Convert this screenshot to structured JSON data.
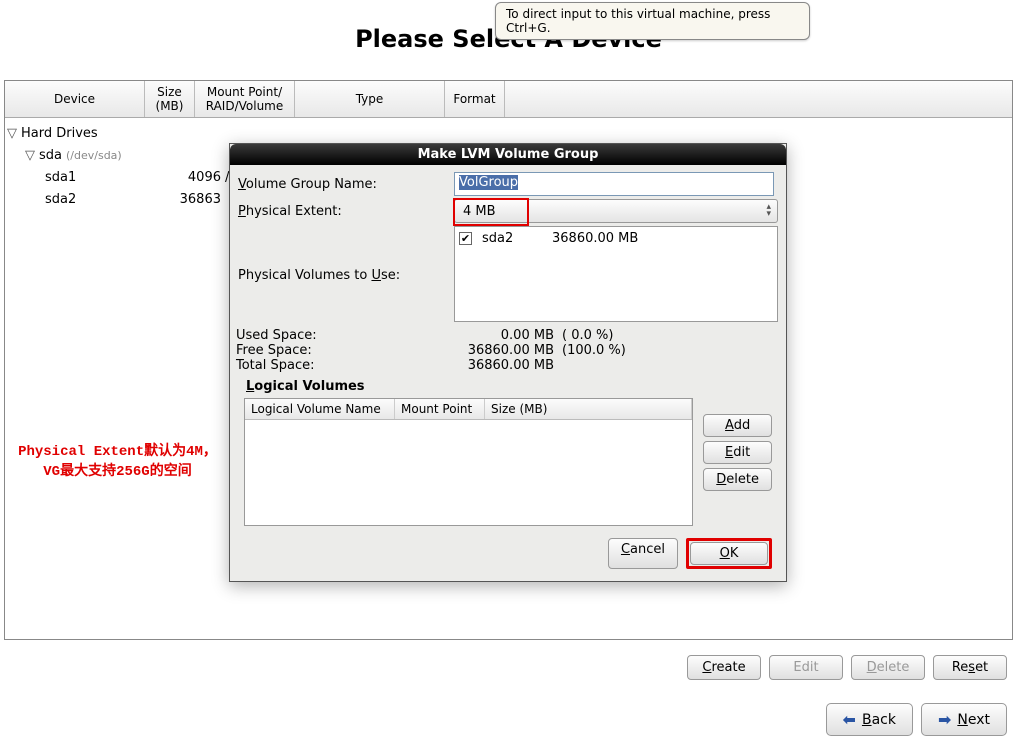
{
  "tooltip": "To direct input to this virtual machine, press Ctrl+G.",
  "page_title": "Please Select A Device",
  "columns": {
    "device": "Device",
    "size_l1": "Size",
    "size_l2": "(MB)",
    "mp_l1": "Mount Point/",
    "mp_l2": "RAID/Volume",
    "type": "Type",
    "format": "Format"
  },
  "tree": {
    "hd": "Hard Drives",
    "sda": "sda",
    "sda_hint": "(/dev/sda)",
    "rows": [
      {
        "name": "sda1",
        "size": "4096",
        "mp": "/boo"
      },
      {
        "name": "sda2",
        "size": "36863",
        "mp": ""
      }
    ]
  },
  "annotation": "Physical Extent默认为4M，\nVG最大支持256G的空间",
  "dialog": {
    "title": "Make LVM Volume Group",
    "vg_label": "Volume Group Name:",
    "vg_value": "VolGroup",
    "pe_label": "Physical Extent:",
    "pe_value": "4 MB",
    "pvu_label": "Physical Volumes to Use:",
    "pv_row": {
      "name": "sda2",
      "size": "36860.00 MB"
    },
    "stats": {
      "used_k": "Used Space:",
      "used_v": "0.00 MB",
      "used_p": "( 0.0 %)",
      "free_k": "Free Space:",
      "free_v": "36860.00 MB",
      "free_p": "(100.0 %)",
      "total_k": "Total Space:",
      "total_v": "36860.00 MB",
      "total_p": ""
    },
    "lv_head": "Logical Volumes",
    "lv_cols": {
      "name": "Logical Volume Name",
      "mp": "Mount Point",
      "size": "Size (MB)"
    },
    "btns": {
      "add": "Add",
      "edit": "Edit",
      "del": "Delete"
    },
    "cancel": "Cancel",
    "ok": "OK"
  },
  "toolbar": {
    "create": "Create",
    "edit": "Edit",
    "delete": "Delete",
    "reset": "Reset"
  },
  "nav": {
    "back": "Back",
    "next": "Next"
  }
}
